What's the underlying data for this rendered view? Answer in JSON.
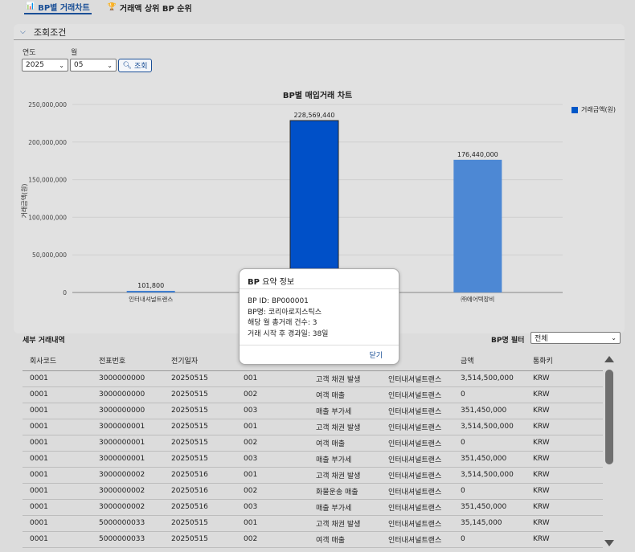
{
  "tabs": [
    {
      "label": "BP별 거래차트",
      "icon": "bar-chart-icon",
      "active": true
    },
    {
      "label": "거래액 상위 BP 순위",
      "icon": "trophy-icon",
      "active": false
    }
  ],
  "conditions": {
    "title": "조회조건",
    "year_label": "연도",
    "year_value": "2025",
    "month_label": "월",
    "month_value": "05",
    "search_label": "조회"
  },
  "chart_data": {
    "type": "bar",
    "title": "BP별 매입거래 차트",
    "ylabel": "거래금액(원)",
    "xlabel": "",
    "ylim": [
      0,
      250000000
    ],
    "yticks": [
      "0",
      "50,000,000",
      "100,000,000",
      "150,000,000",
      "200,000,000",
      "250,000,000"
    ],
    "categories": [
      "인터내셔널트랜스",
      "코리아로지스틱스",
      "㈜에어텍장비"
    ],
    "series": [
      {
        "name": "거래금액(원)",
        "values": [
          101800,
          228569440,
          176440000
        ]
      }
    ],
    "value_labels": [
      "101,800",
      "228,569,440",
      "176,440,000"
    ],
    "legend_position": "top-right",
    "colors": [
      "#3f7fd0",
      "#0050c8",
      "#4d88d4"
    ]
  },
  "detail": {
    "title": "세부 거래내역",
    "filter_label": "BP명 필터",
    "filter_value": "전체",
    "columns": [
      "회사코드",
      "전표번호",
      "전기일자",
      "",
      "",
      "",
      "금액",
      "통화키"
    ],
    "rows": [
      [
        "0001",
        "3000000000",
        "20250515",
        "001",
        "고객 채권 발생",
        "인터내셔널트랜스",
        "3,514,500,000",
        "KRW"
      ],
      [
        "0001",
        "3000000000",
        "20250515",
        "002",
        "여객 매출",
        "인터내셔널트랜스",
        "0",
        "KRW"
      ],
      [
        "0001",
        "3000000000",
        "20250515",
        "003",
        "매출 부가세",
        "인터내셔널트랜스",
        "351,450,000",
        "KRW"
      ],
      [
        "0001",
        "3000000001",
        "20250515",
        "001",
        "고객 채권 발생",
        "인터내셔널트랜스",
        "3,514,500,000",
        "KRW"
      ],
      [
        "0001",
        "3000000001",
        "20250515",
        "002",
        "여객 매출",
        "인터내셔널트랜스",
        "0",
        "KRW"
      ],
      [
        "0001",
        "3000000001",
        "20250515",
        "003",
        "매출 부가세",
        "인터내셔널트랜스",
        "351,450,000",
        "KRW"
      ],
      [
        "0001",
        "3000000002",
        "20250516",
        "001",
        "고객 채권 발생",
        "인터내셔널트랜스",
        "3,514,500,000",
        "KRW"
      ],
      [
        "0001",
        "3000000002",
        "20250516",
        "002",
        "화물운송 매출",
        "인터내셔널트랜스",
        "0",
        "KRW"
      ],
      [
        "0001",
        "3000000002",
        "20250516",
        "003",
        "매출 부가세",
        "인터내셔널트랜스",
        "351,450,000",
        "KRW"
      ],
      [
        "0001",
        "5000000033",
        "20250515",
        "001",
        "고객 채권 발생",
        "인터내셔널트랜스",
        "35,145,000",
        "KRW"
      ],
      [
        "0001",
        "5000000033",
        "20250515",
        "002",
        "여객 매출",
        "인터내셔널트랜스",
        "0",
        "KRW"
      ]
    ]
  },
  "modal": {
    "title_bold": "BP",
    "title_rest": " 요약 정보",
    "lines": [
      "BP ID: BP000001",
      "BP명: 코리아로지스틱스",
      "해당 월 총거래 건수: 3",
      "거래 시작 후 경과일: 38일"
    ],
    "close_label": "닫기"
  }
}
